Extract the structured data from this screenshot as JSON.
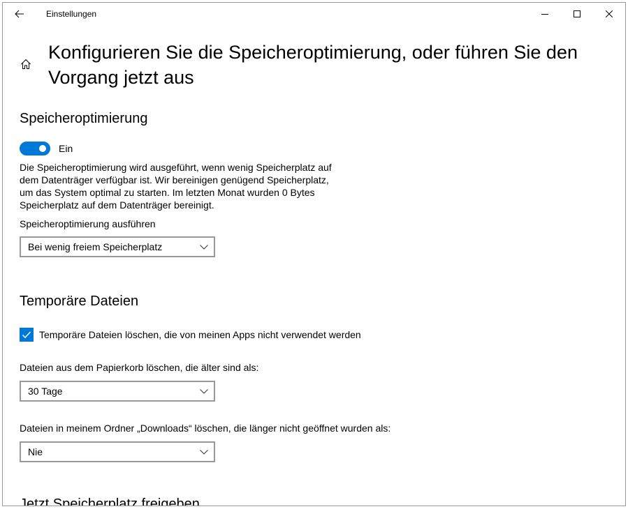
{
  "window": {
    "title": "Einstellungen"
  },
  "colors": {
    "accent": "#0078d7"
  },
  "icons": {
    "back": "back-arrow-icon",
    "minimize": "minimize-icon",
    "maximize": "maximize-icon",
    "close": "close-icon",
    "home": "home-icon",
    "dropdown": "chevron-down-icon",
    "checkbox": "checkmark-icon"
  },
  "page": {
    "title_lines": [
      "Konfigurieren Sie die Speicheroptimierung, oder führen Sie den",
      "Vorgang jetzt aus"
    ]
  },
  "storage_sense": {
    "heading": "Speicheroptimierung",
    "toggle": {
      "on": true,
      "state_label": "Ein"
    },
    "description_lines": [
      "Die Speicheroptimierung wird ausgeführt, wenn wenig Speicherplatz auf",
      "dem Datenträger verfügbar ist. Wir bereinigen genügend Speicherplatz,",
      "um das System optimal zu starten. Im letzten Monat wurden 0 Bytes",
      "Speicherplatz auf dem Datenträger bereinigt."
    ],
    "run_label": "Speicheroptimierung ausführen",
    "run_dropdown": {
      "selected": "Bei wenig freiem Speicherplatz"
    }
  },
  "temp_files": {
    "heading": "Temporäre Dateien",
    "delete_temp_files": {
      "checked": true,
      "label": "Temporäre Dateien löschen, die von meinen Apps nicht verwendet werden"
    },
    "recycle_bin": {
      "label": "Dateien aus dem Papierkorb löschen, die älter sind als:",
      "selected": "30 Tage"
    },
    "downloads": {
      "label": "Dateien in meinem Ordner „Downloads“ löschen, die länger nicht geöffnet wurden als:",
      "selected": "Nie"
    }
  },
  "free_space_now": {
    "heading": "Jetzt Speicherplatz freigeben"
  }
}
